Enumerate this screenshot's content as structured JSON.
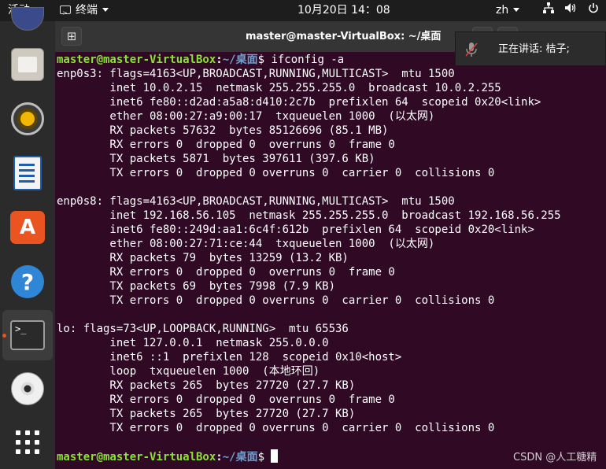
{
  "topbar": {
    "activities": "活动",
    "app_menu": "终端",
    "clock": "10月20日  14：08",
    "input_lang": "zh",
    "icons": [
      "network-icon",
      "volume-icon",
      "power-icon"
    ]
  },
  "dock": {
    "items": [
      "files",
      "rhythmbox",
      "libreoffice-writer",
      "ubuntu-software",
      "help",
      "terminal",
      "dvd",
      "show-applications"
    ],
    "software_glyph": "A",
    "help_glyph": "?",
    "terminal_glyph": ">_",
    "accent_color": "#e95420"
  },
  "window": {
    "title": "master@master-VirtualBox: ~/桌面",
    "new_tab_glyph": "⊞"
  },
  "notification": {
    "text": "正在讲话:  桔子;"
  },
  "terminal": {
    "prompt": {
      "user_host": "master@master-VirtualBox",
      "sep": ":",
      "path": "~/桌面",
      "dollar": "$ "
    },
    "command": "ifconfig -a",
    "lines": [
      "enp0s3: flags=4163<UP,BROADCAST,RUNNING,MULTICAST>  mtu 1500",
      "        inet 10.0.2.15  netmask 255.255.255.0  broadcast 10.0.2.255",
      "        inet6 fe80::d2ad:a5a8:d410:2c7b  prefixlen 64  scopeid 0x20<link>",
      "        ether 08:00:27:a9:00:17  txqueuelen 1000  (以太网)",
      "        RX packets 57632  bytes 85126696 (85.1 MB)",
      "        RX errors 0  dropped 0  overruns 0  frame 0",
      "        TX packets 5871  bytes 397611 (397.6 KB)",
      "        TX errors 0  dropped 0 overruns 0  carrier 0  collisions 0",
      "",
      "enp0s8: flags=4163<UP,BROADCAST,RUNNING,MULTICAST>  mtu 1500",
      "        inet 192.168.56.105  netmask 255.255.255.0  broadcast 192.168.56.255",
      "        inet6 fe80::249d:aa1:6c4f:612b  prefixlen 64  scopeid 0x20<link>",
      "        ether 08:00:27:71:ce:44  txqueuelen 1000  (以太网)",
      "        RX packets 79  bytes 13259 (13.2 KB)",
      "        RX errors 0  dropped 0  overruns 0  frame 0",
      "        TX packets 69  bytes 7998 (7.9 KB)",
      "        TX errors 0  dropped 0 overruns 0  carrier 0  collisions 0",
      "",
      "lo: flags=73<UP,LOOPBACK,RUNNING>  mtu 65536",
      "        inet 127.0.0.1  netmask 255.0.0.0",
      "        inet6 ::1  prefixlen 128  scopeid 0x10<host>",
      "        loop  txqueuelen 1000  (本地环回)",
      "        RX packets 265  bytes 27720 (27.7 KB)",
      "        RX errors 0  dropped 0  overruns 0  frame 0",
      "        TX packets 265  bytes 27720 (27.7 KB)",
      "        TX errors 0  dropped 0 overruns 0  carrier 0  collisions 0"
    ]
  },
  "watermark": "CSDN @人工糖精"
}
